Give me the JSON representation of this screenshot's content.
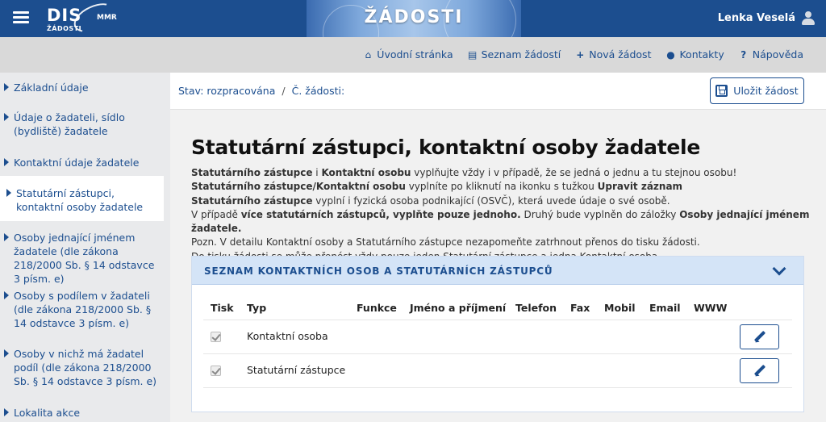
{
  "header": {
    "logo_text": "DIS",
    "logo_sub": "ŽÁDOSTI",
    "logo_mmr": "MMR",
    "banner_title": "ŽÁDOSTI",
    "user_name": "Lenka Veselá",
    "colors": {
      "primary": "#1c4e8f",
      "panel_head": "#d4e4f7"
    }
  },
  "nav": {
    "items": [
      {
        "label": "Úvodní stránka",
        "icon": "home-icon"
      },
      {
        "label": "Seznam žádostí",
        "icon": "list-icon"
      },
      {
        "label": "Nová žádost",
        "icon": "plus-icon"
      },
      {
        "label": "Kontakty",
        "icon": "users-icon"
      },
      {
        "label": "Nápověda",
        "icon": "question-icon"
      }
    ]
  },
  "sidebar": {
    "items": [
      {
        "label": "Základní údaje"
      },
      {
        "label": "Údaje o žadateli, sídlo (bydliště) žadatele"
      },
      {
        "label": "Kontaktní údaje žadatele"
      },
      {
        "label": "Statutární zástupci, kontaktní osoby žadatele"
      },
      {
        "label": "Osoby jednající jménem žadatele (dle zákona 218/2000 Sb. § 14 odstavce 3 písm. e)"
      },
      {
        "label": "Osoby s podílem v žadateli (dle zákona 218/2000 Sb. § 14 odstavce 3 písm. e)"
      },
      {
        "label": "Osoby v nichž má žadatel podíl (dle zákona 218/2000 Sb. § 14 odstavce 3 písm. e)"
      },
      {
        "label": "Lokalita akce"
      }
    ],
    "active_index": 3
  },
  "status": {
    "state": "Stav: rozpracována",
    "separator": "/",
    "number": "Č. žádosti:",
    "save_label": "Uložit žádost"
  },
  "main": {
    "title": "Statutární zástupci, kontaktní osoby žadatele",
    "info": {
      "l1_b1": "Statutárního zástupce",
      "l1_t1": " i ",
      "l1_b2": "Kontaktní osobu",
      "l1_t2": " vyplňujte vždy i v případě, že se jedná o jednu a tu stejnou osobu!",
      "l2_b1": "Statutárního zástupce/Kontaktní osobu",
      "l2_t1": " vyplníte po kliknutí na ikonku s tužkou ",
      "l2_b2": "Upravit záznam",
      "l3_b1": "Statutárního zástupce",
      "l3_t1": " vyplní i fyzická osoba podnikající (OSVČ), která uvede údaje o své osobě.",
      "l4_t1": "V případě ",
      "l4_b1": "více statutárních zástupců, vyplňte pouze jednoho.",
      "l4_t2": " Druhý bude vyplněn do záložky ",
      "l4_b2": "Osoby jednající jménem žadatele.",
      "l5_t1": "Pozn. V detailu Kontaktní osoby a Statutárního zástupce nezapomeňte zatrhnout přenos do tisku žádosti.",
      "l6_t1": "Do tisku žádosti se může přenést vždy pouze jeden Statutární zástupce a jedna Kontaktní osoba."
    }
  },
  "panel": {
    "title": "SEZNAM KONTAKTNÍCH OSOB A STATUTÁRNÍCH ZÁSTUPCŮ",
    "columns": [
      "Tisk",
      "Typ",
      "Funkce",
      "Jméno a příjmení",
      "Telefon",
      "Fax",
      "Mobil",
      "Email",
      "WWW"
    ],
    "rows": [
      {
        "print": true,
        "type": "Kontaktní osoba"
      },
      {
        "print": true,
        "type": "Statutární zástupce"
      }
    ]
  }
}
